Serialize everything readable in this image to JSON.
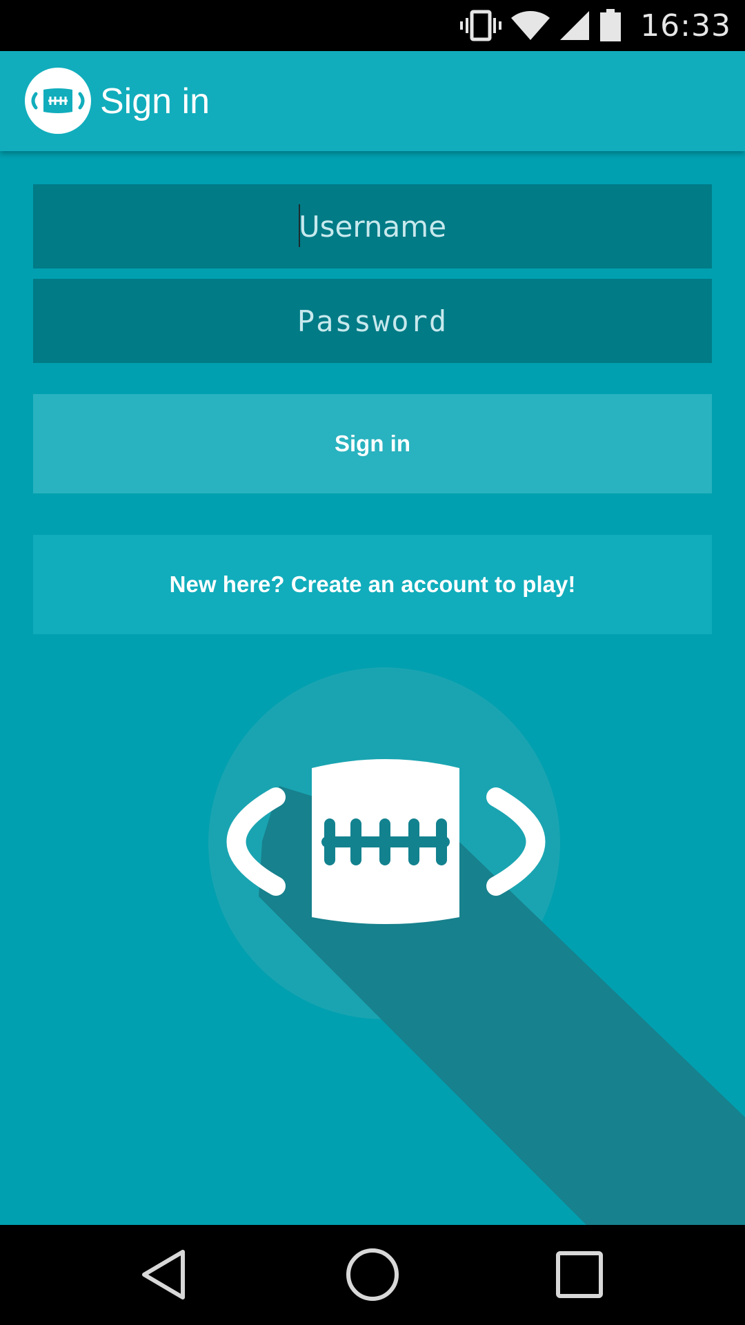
{
  "status_bar": {
    "time": "16:33",
    "icons": [
      "vibrate-icon",
      "wifi-icon",
      "signal-icon",
      "battery-icon"
    ]
  },
  "app_bar": {
    "title": "Sign in",
    "logo_icon": "football-icon"
  },
  "form": {
    "username_placeholder": "Username",
    "username_value": "",
    "password_placeholder": "Password",
    "password_value": ""
  },
  "buttons": {
    "sign_in_label": "Sign in",
    "create_account_label": "New here? Create an account to play!"
  },
  "hero": {
    "icon": "football-icon"
  },
  "navigation": {
    "icons": [
      "back-icon",
      "home-icon",
      "recents-icon"
    ]
  },
  "colors": {
    "background": "#00a0b0",
    "app_bar": "#11adbc",
    "input_background": "#017b86",
    "sign_in_button": "#29b2bf",
    "create_button": "#11adbc",
    "long_shadow": "#17818d"
  }
}
